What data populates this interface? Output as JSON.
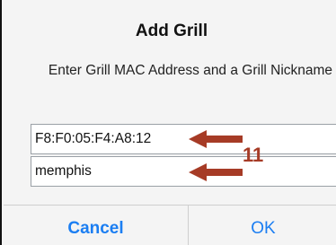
{
  "dialog": {
    "title": "Add Grill",
    "message": "Enter Grill MAC Address and a Grill Nickname",
    "fields": {
      "mac_value": "F8:F0:05:F4:A8:12",
      "nickname_value": "memphis"
    },
    "buttons": {
      "cancel": "Cancel",
      "ok": "OK"
    }
  },
  "annotation": {
    "number": "11",
    "color": "#a63b26"
  },
  "colors": {
    "accent": "#1b7ef2",
    "dialog_background": "#f4f4f4"
  }
}
